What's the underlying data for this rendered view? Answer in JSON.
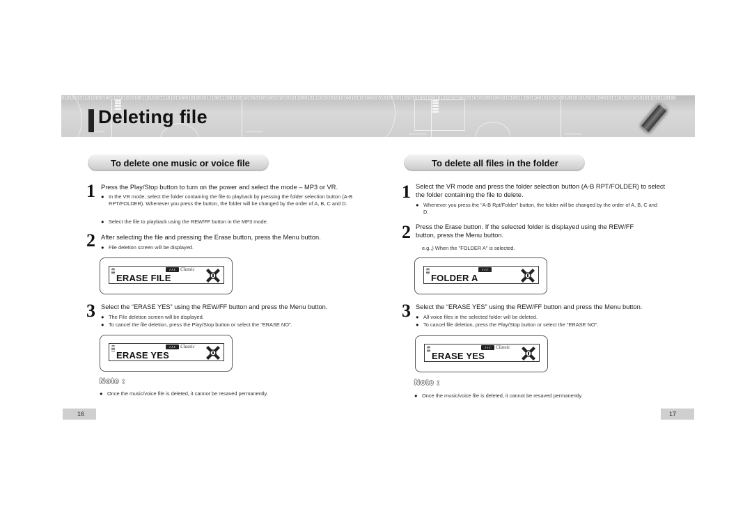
{
  "header": {
    "title": "Deleting file",
    "binary_left": "0101001011010100100110101010100110101011101011000101001011100111001100101010100100101010101100010111010101010100101101001010101",
    "binary_right": "0101001011010101001100101010101001011010100010010111001110011001010101001001010101011000101110101010101011010110100"
  },
  "left_section": {
    "heading": "To delete one music or voice file",
    "steps": [
      {
        "number": "1",
        "text": "Press the Play/Stop button to turn on the power and select the mode – MP3 or VR.",
        "bullets": [
          "In the VR mode, select the folder containing the file to playback by pressing the folder selection button (A-B RPT/FOLDER). Whenever you press the button, the folder will be changed by the order of A, B, C and D.",
          "Select the file to playback using the REW/FF button in the MP3 mode."
        ]
      },
      {
        "number": "2",
        "text": "After selecting the file and pressing the Erase button, press the Menu button.",
        "bullets": [
          "File deletion screen will be displayed."
        ]
      },
      {
        "number": "3",
        "text": "Select the “ERASE YES” using the REW/FF button and press the Menu button.",
        "bullets": [
          "The File deletion screen will be displayed.",
          "To cancel the file deletion, press the Play/Stop button or select the \"ERASE NO\"."
        ]
      }
    ],
    "lcd_1": {
      "text": "ERASE FILE",
      "brand": "Classic"
    },
    "lcd_2": {
      "text": "ERASE YES",
      "brand": "Classic"
    },
    "note_title": "Note :",
    "note_text": "Once the music/voice file is deleted, it cannot be resaved permanently.",
    "page_number": "16"
  },
  "right_section": {
    "heading": "To delete all files in the folder",
    "steps": [
      {
        "number": "1",
        "text": "Select the VR mode and press the folder selection button (A-B RPT/FOLDER) to select the folder containing the file to delete.",
        "bullets": [
          "Whenever you press the \"A-B Rpt/Folder\" button, the folder will be changed by the order of A, B, C and D."
        ]
      },
      {
        "number": "2",
        "text": "Press the Erase button. If the selected folder is displayed using the REW/FF button, press the Menu button.",
        "example": "e.g.,) When the \"FOLDER A\" is selected."
      },
      {
        "number": "3",
        "text": "Select the “ERASE YES” using the REW/FF button and press the Menu button.",
        "bullets": [
          "All voice files in the selected folder will be deleted.",
          "To cancel file deletion, press the Play/Stop button or select the \"ERASE NO\"."
        ]
      }
    ],
    "lcd_1": {
      "text": "FOLDER A"
    },
    "lcd_2": {
      "text": "ERASE YES",
      "brand": "Classic"
    },
    "note_title": "Note :",
    "note_text": "Once the music/voice file is deleted, it cannot be resaved permanently.",
    "page_number": "17"
  }
}
